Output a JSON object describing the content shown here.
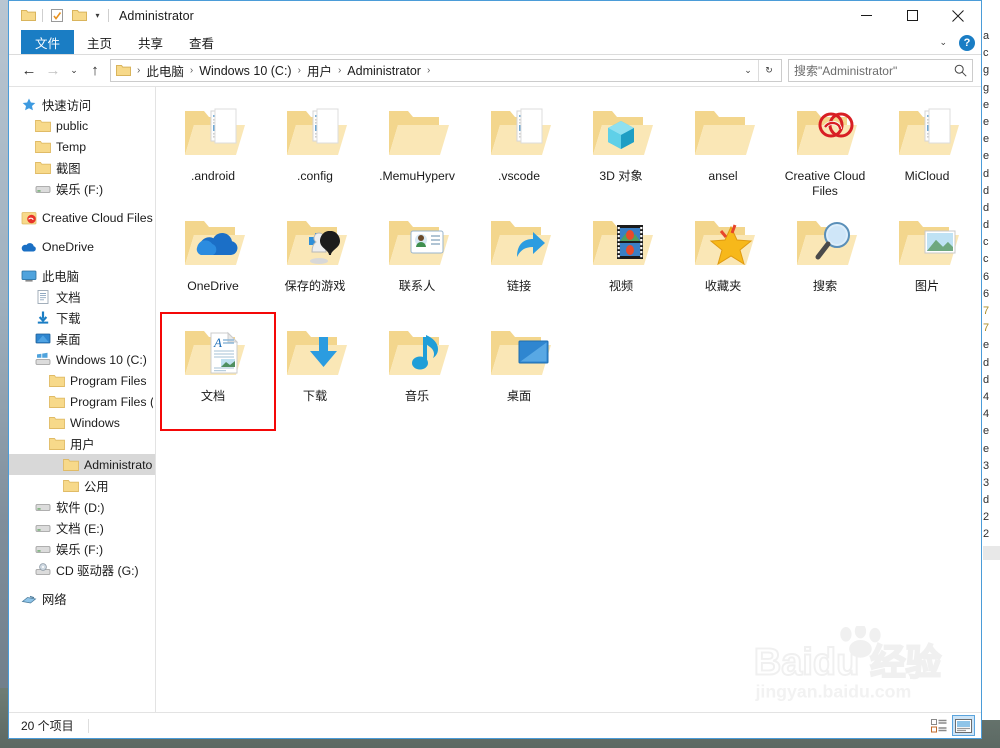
{
  "window": {
    "title": "Administrator",
    "qat": [
      {
        "name": "folder-icon",
        "label": "文件夹"
      },
      {
        "name": "properties-icon",
        "label": "属性"
      },
      {
        "name": "new-folder-icon",
        "label": "新建文件夹"
      }
    ],
    "qat_dropdown": "▾",
    "controls": {
      "minimize": "最小化",
      "maximize": "最大化",
      "close": "关闭"
    }
  },
  "ribbon": {
    "tabs": [
      {
        "label": "文件",
        "active": true
      },
      {
        "label": "主页",
        "active": false
      },
      {
        "label": "共享",
        "active": false
      },
      {
        "label": "查看",
        "active": false
      }
    ],
    "collapse_chevron": "⌄",
    "help_label": "?"
  },
  "address": {
    "back": "←",
    "forward": "→",
    "recent": "⌄",
    "up": "↑",
    "breadcrumbs": [
      "此电脑",
      "Windows 10 (C:)",
      "用户",
      "Administrator"
    ],
    "separator": "›",
    "trailing_separator": "›",
    "dropdown": "⌄",
    "refresh": "↻"
  },
  "search": {
    "placeholder": "搜索\"Administrator\"",
    "icon": "search-icon"
  },
  "sidebar": {
    "groups": [
      {
        "header": {
          "label": "快速访问",
          "icon": "star-pin-icon",
          "indent": 0
        },
        "items": [
          {
            "label": "public",
            "icon": "folder-icon",
            "indent": 1
          },
          {
            "label": "Temp",
            "icon": "folder-icon",
            "indent": 1
          },
          {
            "label": "截图",
            "icon": "folder-icon",
            "indent": 1
          },
          {
            "label": "娱乐 (F:)",
            "icon": "drive-icon",
            "indent": 1
          }
        ]
      },
      {
        "header": {
          "label": "Creative Cloud Files",
          "icon": "creative-cloud-icon",
          "indent": 0
        },
        "items": []
      },
      {
        "header": {
          "label": "OneDrive",
          "icon": "onedrive-icon",
          "indent": 0
        },
        "items": []
      },
      {
        "header": {
          "label": "此电脑",
          "icon": "this-pc-icon",
          "indent": 0
        },
        "items": [
          {
            "label": "文档",
            "icon": "documents-icon",
            "indent": 1
          },
          {
            "label": "下载",
            "icon": "downloads-icon",
            "indent": 1
          },
          {
            "label": "桌面",
            "icon": "desktop-icon",
            "indent": 1
          },
          {
            "label": "Windows 10 (C:)",
            "icon": "windows-drive-icon",
            "indent": 1
          },
          {
            "label": "Program Files",
            "icon": "folder-icon",
            "indent": 2
          },
          {
            "label": "Program Files (x",
            "icon": "folder-icon",
            "indent": 2
          },
          {
            "label": "Windows",
            "icon": "folder-icon",
            "indent": 2
          },
          {
            "label": "用户",
            "icon": "folder-icon",
            "indent": 2
          },
          {
            "label": "Administrator",
            "icon": "folder-icon",
            "indent": 3,
            "selected": true
          },
          {
            "label": "公用",
            "icon": "folder-icon",
            "indent": 3
          },
          {
            "label": "软件 (D:)",
            "icon": "drive-icon",
            "indent": 1
          },
          {
            "label": "文档 (E:)",
            "icon": "drive-icon",
            "indent": 1
          },
          {
            "label": "娱乐 (F:)",
            "icon": "drive-icon",
            "indent": 1
          },
          {
            "label": "CD 驱动器 (G:)",
            "icon": "cd-drive-icon",
            "indent": 1
          }
        ]
      },
      {
        "header": {
          "label": "网络",
          "icon": "network-icon",
          "indent": 0
        },
        "items": []
      }
    ]
  },
  "files": [
    {
      "label": ".android",
      "icon": "folder-docpeek-icon"
    },
    {
      "label": ".config",
      "icon": "folder-docpeek-icon"
    },
    {
      "label": ".MemuHyperv",
      "icon": "folder-plain-icon"
    },
    {
      "label": ".vscode",
      "icon": "folder-docpeek-icon"
    },
    {
      "label": "3D 对象",
      "icon": "folder-3dobjects-icon"
    },
    {
      "label": "ansel",
      "icon": "folder-plain-icon"
    },
    {
      "label": "Creative Cloud Files",
      "icon": "folder-creativecloud-icon"
    },
    {
      "label": "MiCloud",
      "icon": "folder-docpeek-icon"
    },
    {
      "label": "OneDrive",
      "icon": "folder-onedrive-icon"
    },
    {
      "label": "保存的游戏",
      "icon": "folder-savedgames-icon"
    },
    {
      "label": "联系人",
      "icon": "folder-contacts-icon"
    },
    {
      "label": "链接",
      "icon": "folder-links-icon"
    },
    {
      "label": "视频",
      "icon": "folder-videos-icon"
    },
    {
      "label": "收藏夹",
      "icon": "folder-favorites-icon"
    },
    {
      "label": "搜索",
      "icon": "folder-searches-icon"
    },
    {
      "label": "图片",
      "icon": "folder-pictures-icon"
    },
    {
      "label": "文档",
      "icon": "folder-documents-icon",
      "annotated": true
    },
    {
      "label": "下载",
      "icon": "folder-downloads-icon"
    },
    {
      "label": "音乐",
      "icon": "folder-music-icon"
    },
    {
      "label": "桌面",
      "icon": "folder-desktop-icon"
    }
  ],
  "annotation": {
    "color": "#f40808",
    "target": "文档"
  },
  "status": {
    "item_count": "20 个项目",
    "views": [
      {
        "name": "details-view",
        "active": false
      },
      {
        "name": "large-icons-view",
        "active": true
      }
    ]
  },
  "watermark": {
    "brand": "Baidu",
    "brand_cn": "经验",
    "url": "jingyan.baidu.com"
  },
  "background_window": {
    "lines": [
      "a",
      "c",
      "g",
      "g",
      "e",
      "e",
      "e",
      "e",
      "d",
      "d",
      "d",
      "d",
      "c",
      "c",
      "6",
      "6",
      "7",
      "7",
      "e",
      "d",
      "d",
      "4",
      "4",
      "e",
      "e",
      "3",
      "3",
      "d",
      "2",
      "2"
    ]
  },
  "colors": {
    "accent": "#1a7dc4",
    "folder": "#f7d98a",
    "annotation": "#f40808",
    "selection": "#d8d8d8",
    "window_border": "#4b9cd8"
  }
}
